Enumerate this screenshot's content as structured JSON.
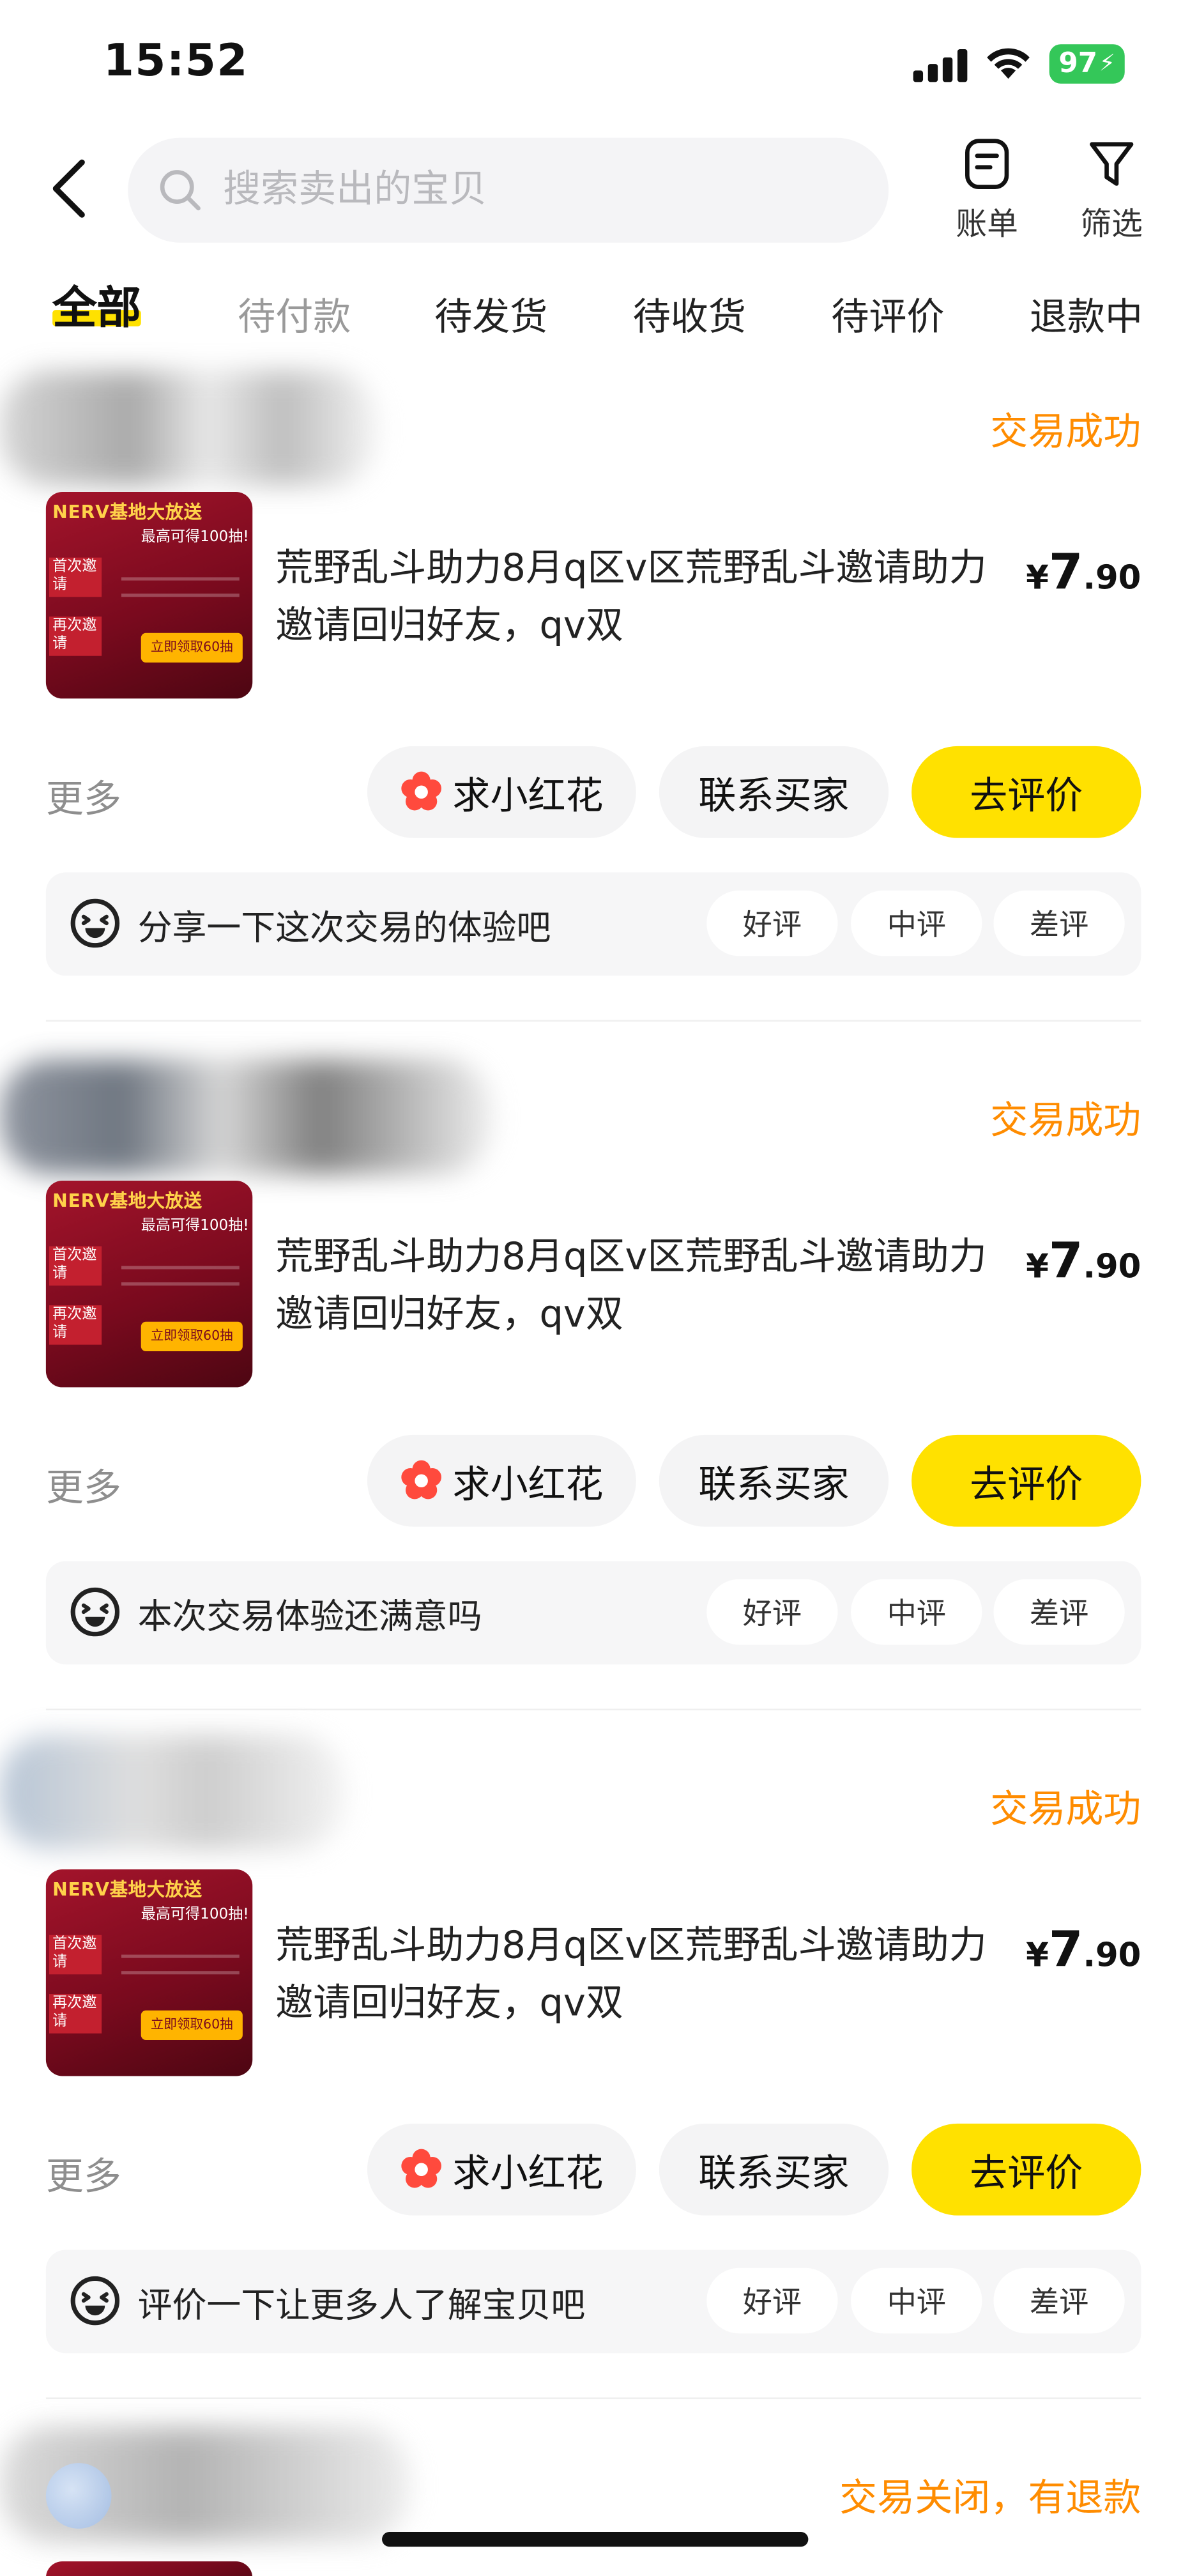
{
  "status_bar": {
    "time": "15:52",
    "battery": "97"
  },
  "search": {
    "placeholder": "搜索卖出的宝贝"
  },
  "header_actions": {
    "bill_label": "账单",
    "filter_label": "筛选"
  },
  "tabs": [
    {
      "label": "全部",
      "active": true
    },
    {
      "label": "待付款",
      "active": false
    },
    {
      "label": "待发货",
      "active": false
    },
    {
      "label": "待收货",
      "active": false
    },
    {
      "label": "待评价",
      "active": false
    },
    {
      "label": "退款中",
      "active": false
    }
  ],
  "orders": [
    {
      "status": "交易成功",
      "title": "荒野乱斗助力8月q区v区荒野乱斗邀请助力邀请回归好友，qv双",
      "price_symbol": "¥",
      "price_int": "7",
      "price_dec": ".90",
      "more_label": "更多",
      "flower_label": "求小红花",
      "contact_label": "联系买家",
      "review_button_label": "去评价",
      "review_prompt": "分享一下这次交易的体验吧",
      "ratings": [
        "好评",
        "中评",
        "差评"
      ],
      "thumb": {
        "headline": "NERV基地大放送",
        "sub": "最高可得100抽!",
        "badge1": "首次邀请",
        "badge2": "再次邀请",
        "button": "立即领取60抽"
      }
    },
    {
      "status": "交易成功",
      "title": "荒野乱斗助力8月q区v区荒野乱斗邀请助力邀请回归好友，qv双",
      "price_symbol": "¥",
      "price_int": "7",
      "price_dec": ".90",
      "more_label": "更多",
      "flower_label": "求小红花",
      "contact_label": "联系买家",
      "review_button_label": "去评价",
      "review_prompt": "本次交易体验还满意吗",
      "ratings": [
        "好评",
        "中评",
        "差评"
      ],
      "thumb": {
        "headline": "NERV基地大放送",
        "sub": "最高可得100抽!",
        "badge1": "首次邀请",
        "badge2": "再次邀请",
        "button": "立即领取60抽"
      }
    },
    {
      "status": "交易成功",
      "title": "荒野乱斗助力8月q区v区荒野乱斗邀请助力邀请回归好友，qv双",
      "price_symbol": "¥",
      "price_int": "7",
      "price_dec": ".90",
      "more_label": "更多",
      "flower_label": "求小红花",
      "contact_label": "联系买家",
      "review_button_label": "去评价",
      "review_prompt": "评价一下让更多人了解宝贝吧",
      "ratings": [
        "好评",
        "中评",
        "差评"
      ],
      "thumb": {
        "headline": "NERV基地大放送",
        "sub": "最高可得100抽!",
        "badge1": "首次邀请",
        "badge2": "再次邀请",
        "button": "立即领取60抽"
      }
    }
  ],
  "last_order": {
    "status": "交易关闭，有退款"
  },
  "colors": {
    "accent_yellow": "#ffe100",
    "status_orange": "#ff8c00",
    "battery_green": "#34c759"
  }
}
